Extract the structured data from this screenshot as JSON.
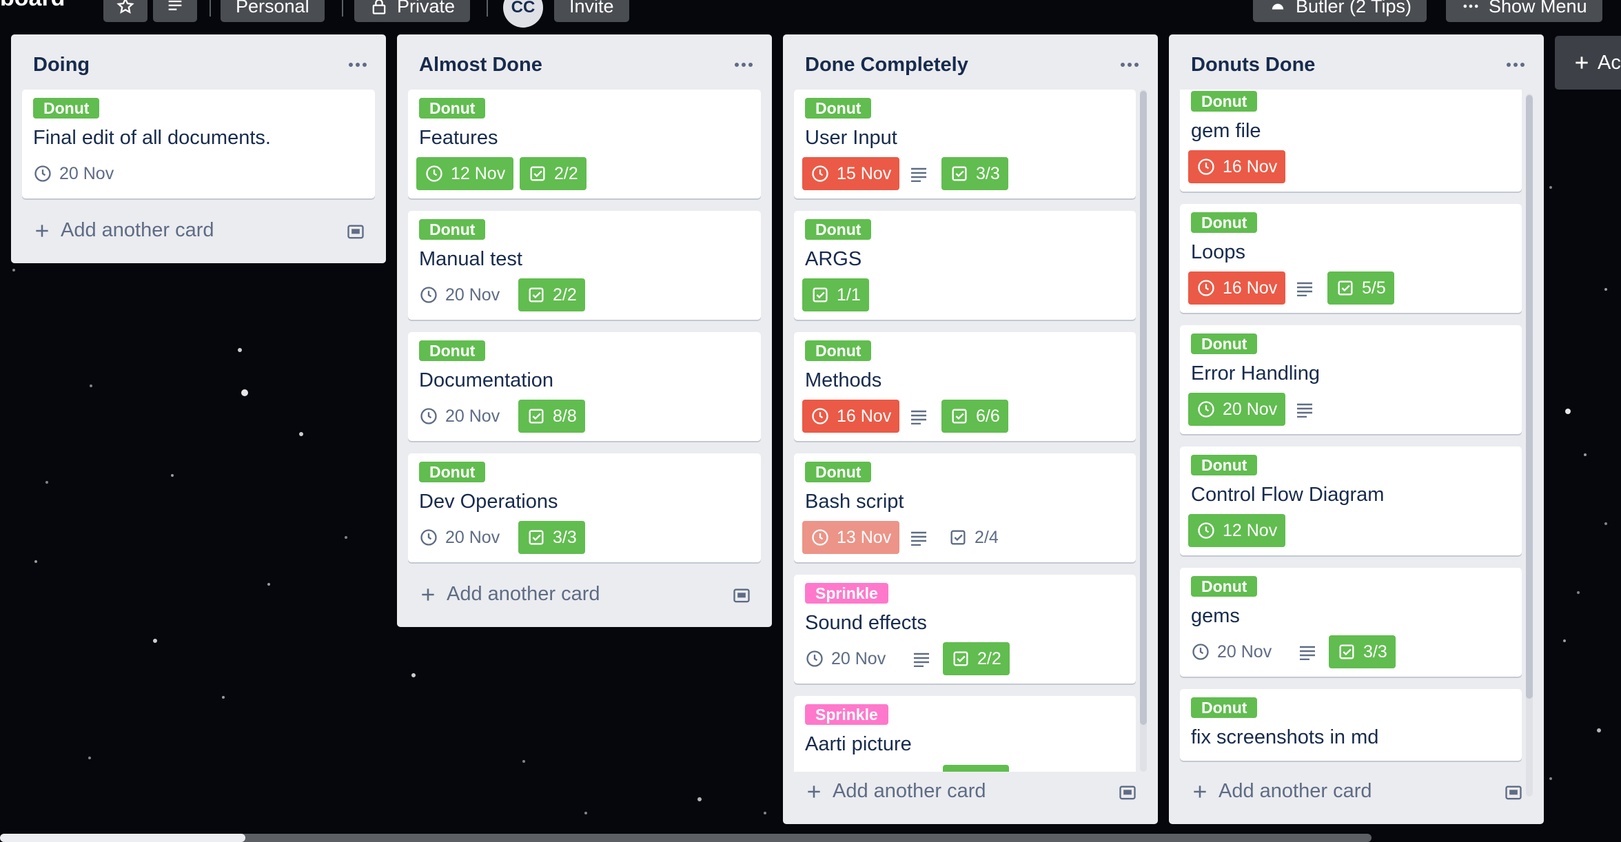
{
  "header": {
    "board_title": "board",
    "workspace_label": "Personal",
    "visibility_label": "Private",
    "avatar_initials": "CC",
    "invite_label": "Invite",
    "butler_label": "Butler (2 Tips)",
    "show_menu_label": "Show Menu",
    "add_list_label": "Ac"
  },
  "common": {
    "add_card_label": "Add another card"
  },
  "colors": {
    "label_green": "#61bd4f",
    "label_pink": "#ff78cb",
    "due_overdue": "#eb5a46",
    "due_soon": "#ec9488"
  },
  "lists": [
    {
      "title": "Doing",
      "cards": [
        {
          "label": "Donut",
          "title": "Final edit of all documents.",
          "due": "20 Nov",
          "due_state": "none"
        }
      ]
    },
    {
      "title": "Almost Done",
      "cards": [
        {
          "label": "Donut",
          "title": "Features",
          "due": "12 Nov",
          "due_state": "complete",
          "checklist": "2/2"
        },
        {
          "label": "Donut",
          "title": "Manual test",
          "due": "20 Nov",
          "due_state": "none",
          "checklist": "2/2"
        },
        {
          "label": "Donut",
          "title": "Documentation",
          "due": "20 Nov",
          "due_state": "none",
          "checklist": "8/8"
        },
        {
          "label": "Donut",
          "title": "Dev Operations",
          "due": "20 Nov",
          "due_state": "none",
          "checklist": "3/3"
        }
      ]
    },
    {
      "title": "Done Completely",
      "cards": [
        {
          "label": "Donut",
          "title": "User Input",
          "due": "15 Nov",
          "due_state": "overdue",
          "has_description": true,
          "checklist": "3/3"
        },
        {
          "label": "Donut",
          "title": "ARGS",
          "checklist": "1/1"
        },
        {
          "label": "Donut",
          "title": "Methods",
          "due": "16 Nov",
          "due_state": "overdue",
          "has_description": true,
          "checklist": "6/6"
        },
        {
          "label": "Donut",
          "title": "Bash script",
          "due": "13 Nov",
          "due_state": "overdue-light",
          "has_description": true,
          "checklist": "2/4"
        },
        {
          "label": "Sprinkle",
          "title": "Sound effects",
          "due": "20 Nov",
          "due_state": "none",
          "has_description": true,
          "checklist": "2/2"
        },
        {
          "label": "Sprinkle",
          "title": "Aarti picture"
        }
      ]
    },
    {
      "title": "Donuts Done",
      "cards": [
        {
          "label": "Donut",
          "title": "gem file",
          "due": "16 Nov",
          "due_state": "overdue"
        },
        {
          "label": "Donut",
          "title": "Loops",
          "due": "16 Nov",
          "due_state": "overdue",
          "has_description": true,
          "checklist": "5/5"
        },
        {
          "label": "Donut",
          "title": "Error Handling",
          "due": "20 Nov",
          "due_state": "complete",
          "has_description": true
        },
        {
          "label": "Donut",
          "title": "Control Flow Diagram",
          "due": "12 Nov",
          "due_state": "complete"
        },
        {
          "label": "Donut",
          "title": "gems",
          "due": "20 Nov",
          "due_state": "none",
          "has_description": true,
          "checklist": "3/3"
        },
        {
          "label": "Donut",
          "title": "fix screenshots in md"
        }
      ]
    }
  ]
}
